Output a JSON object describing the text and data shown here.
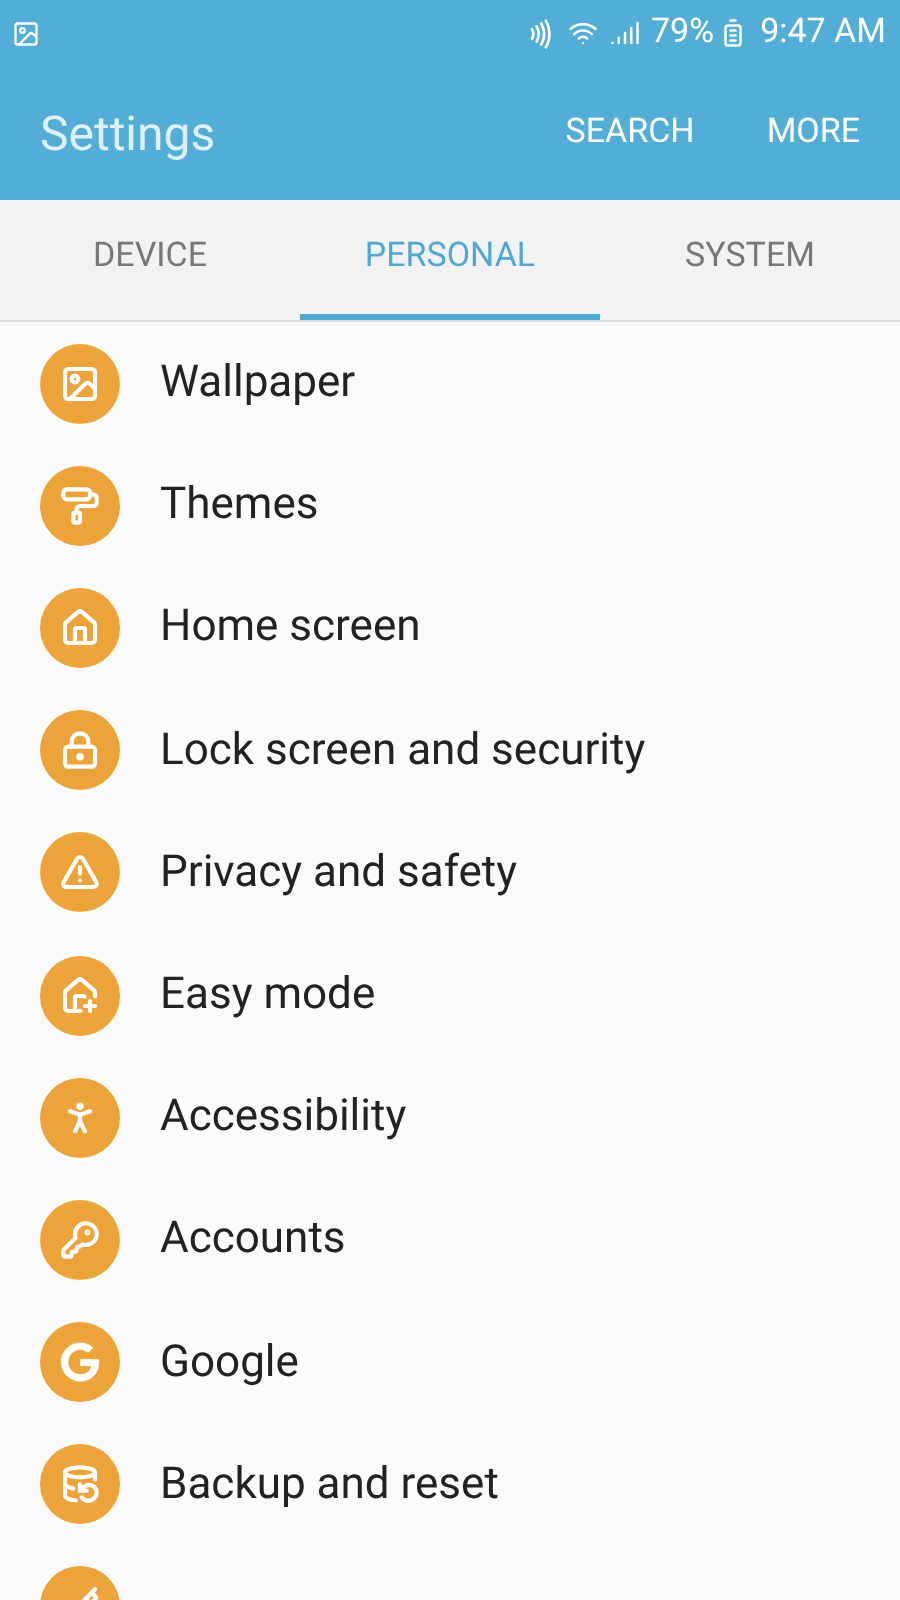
{
  "status_bar": {
    "battery": "79%",
    "time": "9:47 AM"
  },
  "app_bar": {
    "title": "Settings",
    "actions": [
      "SEARCH",
      "MORE"
    ]
  },
  "tabs": [
    {
      "label": "DEVICE",
      "selected": false
    },
    {
      "label": "PERSONAL",
      "selected": true
    },
    {
      "label": "SYSTEM",
      "selected": false
    }
  ],
  "items": [
    {
      "label": "Wallpaper"
    },
    {
      "label": "Themes"
    },
    {
      "label": "Home screen"
    },
    {
      "label": "Lock screen and security"
    },
    {
      "label": "Privacy and safety"
    },
    {
      "label": "Easy mode"
    },
    {
      "label": "Accessibility"
    },
    {
      "label": "Accounts"
    },
    {
      "label": "Google"
    },
    {
      "label": "Backup and reset"
    }
  ],
  "cut_off_item": true
}
